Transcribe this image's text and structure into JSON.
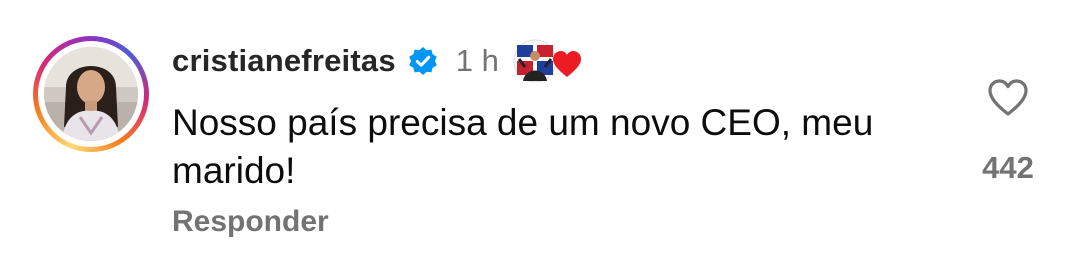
{
  "comment": {
    "username": "cristianefreitas",
    "verified": true,
    "time": "1 h",
    "text": "Nosso país precisa de um novo CEO, meu marido!",
    "reply_label": "Responder",
    "like_count": "442"
  },
  "icons": {
    "verified": "verified-badge-icon",
    "like": "heart-outline-icon",
    "reaction_heart": "red-heart-icon"
  },
  "colors": {
    "username": "#262626",
    "muted": "#737373",
    "verified_blue": "#0095f6",
    "heart_red": "#ed1c24"
  }
}
